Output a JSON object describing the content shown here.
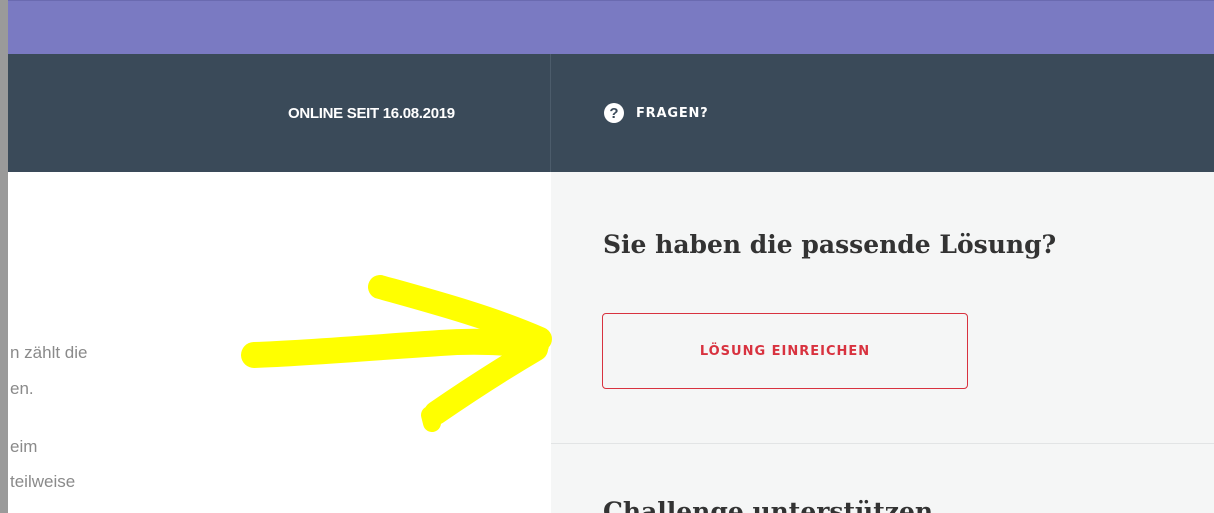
{
  "header": {
    "online_since": "ONLINE SEIT 16.08.2019",
    "help_label": "FRAGEN?",
    "help_icon_glyph": "?"
  },
  "left": {
    "line1": "n zählt die",
    "line2": "en.",
    "line3": "eim",
    "line4": "teilweise"
  },
  "solution_panel": {
    "heading": "Sie haben die passende Lösung?",
    "submit_label": "LÖSUNG EINREICHEN"
  },
  "support_panel": {
    "heading": "Challenge unterstützen"
  },
  "colors": {
    "purple_bar": "#7a7ac2",
    "dark_bar": "#3a4a59",
    "accent_red": "#d8323f",
    "annotation_yellow": "#ffff00"
  }
}
